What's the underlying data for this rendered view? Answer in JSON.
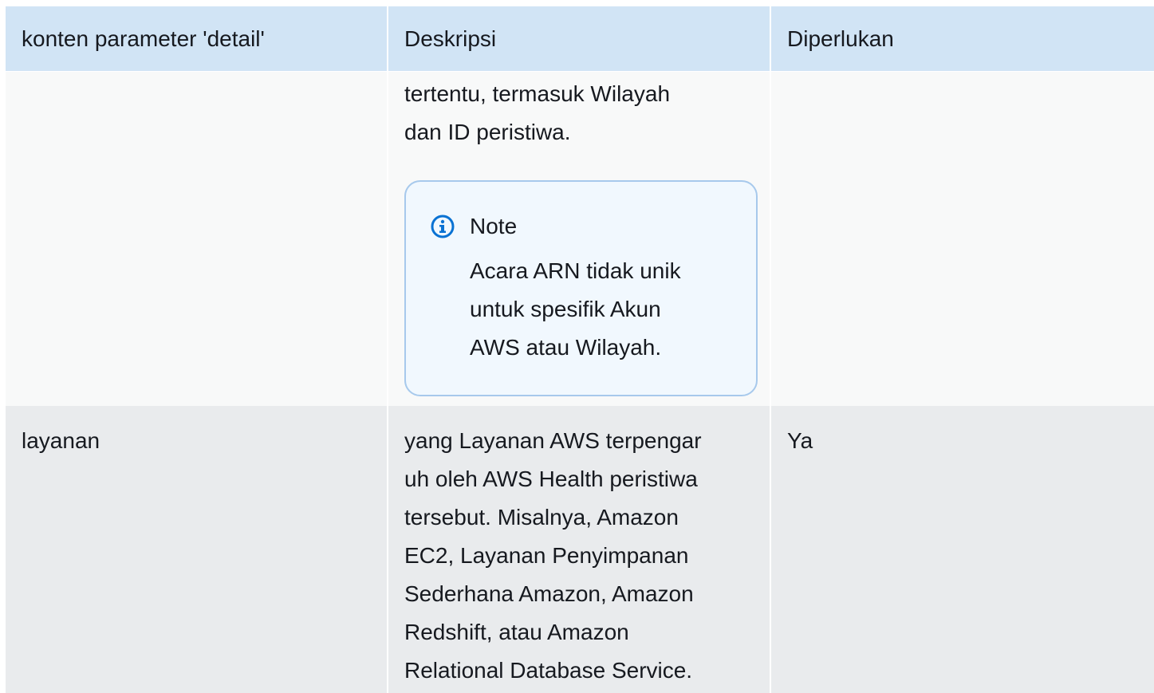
{
  "table": {
    "headers": [
      "konten parameter 'detail'",
      "Deskripsi",
      "Diperlukan"
    ],
    "rows": [
      {
        "parameter": "",
        "description_lines": [
          "tertentu, termasuk Wilayah",
          "dan ID peristiwa."
        ],
        "required": "",
        "note": {
          "icon": "info-circle-icon",
          "title": "Note",
          "lines": [
            "Acara ARN tidak unik",
            "untuk spesifik Akun",
            "AWS atau Wilayah."
          ]
        }
      },
      {
        "parameter": "layanan",
        "description_lines": [
          "yang Layanan AWS terpengar",
          "uh oleh AWS Health peristiwa",
          "tersebut. Misalnya, Amazon",
          "EC2, Layanan Penyimpanan",
          "Sederhana Amazon, Amazon",
          "Redshift, atau Amazon",
          "Relational Database Service."
        ],
        "required": "Ya"
      }
    ]
  },
  "colors": {
    "header_bg": "#d1e4f5",
    "row_light_bg": "#f8f9f9",
    "row_grey_bg": "#e9ebed",
    "note_border": "#a7c9ec",
    "note_bg": "#f1f8fe",
    "info_icon": "#0972d3"
  }
}
